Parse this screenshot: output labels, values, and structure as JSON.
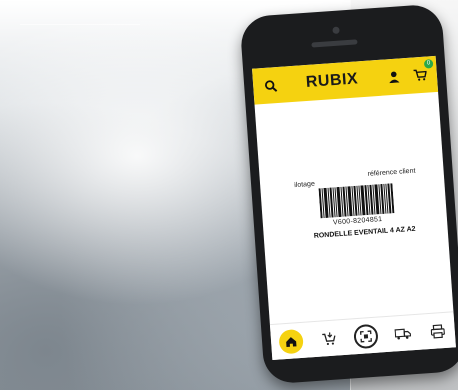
{
  "app": {
    "brand": "RUBIX"
  },
  "header": {
    "search_icon": "search-icon",
    "user_icon": "user-icon",
    "cart_icon": "cart-icon",
    "cart_badge": "0"
  },
  "scan": {
    "label_left": "ilotage",
    "label_right": "référence client",
    "barcode_number": "V600-8204851",
    "product_name": "RONDELLE EVENTAIL 4 AZ A2"
  },
  "nav": {
    "items": [
      "home-icon",
      "order-icon",
      "scan-icon",
      "delivery-truck-icon",
      "printer-icon"
    ]
  },
  "colors": {
    "accent": "#f5d210",
    "badge": "#2aa84a"
  }
}
